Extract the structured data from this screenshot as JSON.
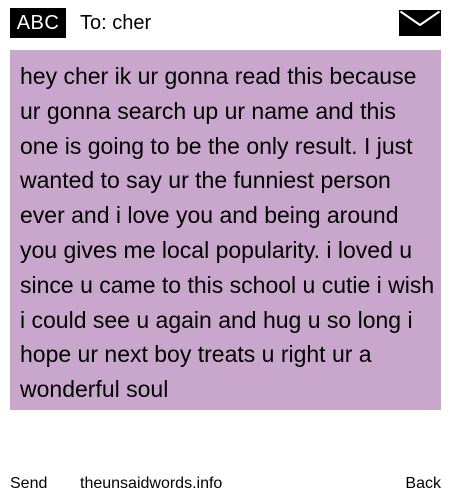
{
  "header": {
    "input_mode": "ABC",
    "to_label": "To:",
    "recipient": "cher",
    "message_icon": "envelope-icon"
  },
  "message": {
    "text": "hey cher ik ur gonna read this because ur gonna search up ur name and this one is going to be the only result. I just wanted to say ur the funniest person ever and i love you and being around you gives me local popularity. i loved u since u came to this school u cutie i wish i could see u again and hug u so long i hope ur next boy treats u right ur a wonderful soul",
    "background_color": "#c9a6cc"
  },
  "footer": {
    "send_label": "Send",
    "site_label": "theunsaidwords.info",
    "back_label": "Back"
  }
}
